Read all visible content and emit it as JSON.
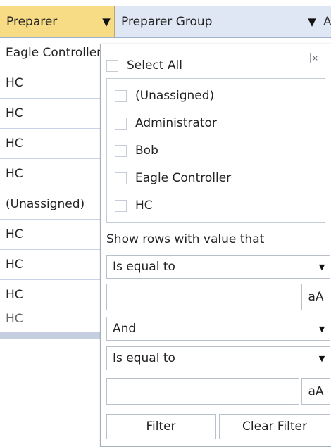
{
  "grid": {
    "columns": [
      {
        "label": "Preparer",
        "filtered": true
      },
      {
        "label": "Preparer Group",
        "filtered": true
      },
      {
        "label": "A"
      }
    ],
    "preparer_cells": [
      "Eagle Controller",
      "HC",
      "HC",
      "HC",
      "HC",
      "(Unassigned)",
      "HC",
      "HC",
      "HC",
      "HC"
    ]
  },
  "filter_popup": {
    "select_all_label": "Select All",
    "close_glyph": "×",
    "options": [
      "(Unassigned)",
      "Administrator",
      "Bob",
      "Eagle Controller",
      "HC"
    ],
    "show_rows_label": "Show rows with value that",
    "condition1": "Is equal to",
    "condition1_value": "",
    "operator": "And",
    "condition2": "Is equal to",
    "condition2_value": "",
    "case_label": "aA",
    "filter_button": "Filter",
    "clear_button": "Clear Filter"
  },
  "icons": {
    "funnel": "filter-funnel-icon",
    "dropdown": "dropdown-arrow-icon",
    "close": "close-icon"
  },
  "colors": {
    "preparer_header_bg": "#f7dc85",
    "header_bg": "#dfe6f4"
  }
}
